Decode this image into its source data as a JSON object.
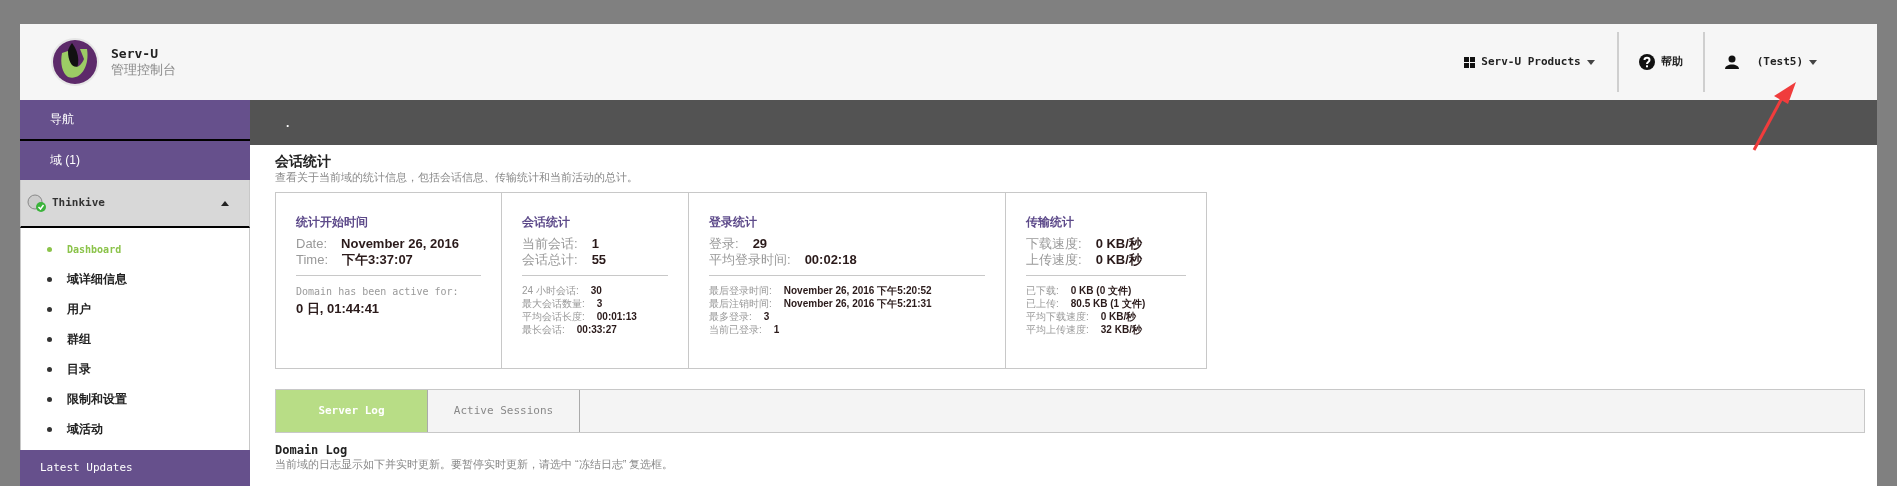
{
  "header": {
    "logo_title": "Serv-U",
    "logo_subtitle": "管理控制台",
    "menus": [
      {
        "kind": "products",
        "label": "Serv-U Products"
      },
      {
        "kind": "help",
        "label": "帮助"
      },
      {
        "kind": "user",
        "label": "(Test5)"
      }
    ]
  },
  "breadcrumb": ".",
  "sidebar": {
    "nav_title": "导航",
    "domains_header": "域 (1)",
    "domain": {
      "name": "Thinkive",
      "expanded": true,
      "items": [
        {
          "label": "Dashboard",
          "selected": true
        },
        {
          "label": "域详细信息",
          "selected": false
        },
        {
          "label": "用户",
          "selected": false
        },
        {
          "label": "群组",
          "selected": false
        },
        {
          "label": "目录",
          "selected": false
        },
        {
          "label": "限制和设置",
          "selected": false
        },
        {
          "label": "域活动",
          "selected": false
        }
      ]
    },
    "latest_updates": "Latest Updates"
  },
  "page": {
    "title": "会话统计",
    "description": "查看关于当前域的统计信息，包括会话信息、传输统计和当前活动的总计。"
  },
  "stats": [
    {
      "kind": "start",
      "title": "统计开始时间",
      "main_rows": [
        {
          "label": "Date:",
          "value": "November 26, 2016"
        },
        {
          "label": "Time:",
          "value": "下午3:37:07"
        }
      ],
      "active_label": "Domain has been active for:",
      "active_value": "0 日, 01:44:41"
    },
    {
      "kind": "list",
      "title": "会话统计",
      "main_rows": [
        {
          "label": "当前会话:",
          "value": "1"
        },
        {
          "label": "会话总计:",
          "value": "55"
        }
      ],
      "detail_rows": [
        {
          "label": "24 小时会话:",
          "value": "30"
        },
        {
          "label": "最大会话数量:",
          "value": "3"
        },
        {
          "label": "平均会话长度:",
          "value": "00:01:13"
        },
        {
          "label": "最长会话:",
          "value": "00:33:27"
        }
      ]
    },
    {
      "kind": "list",
      "title": "登录统计",
      "main_rows": [
        {
          "label": "登录:",
          "value": "29"
        },
        {
          "label": "平均登录时间:",
          "value": "00:02:18"
        }
      ],
      "detail_rows": [
        {
          "label": "最后登录时间:",
          "value": "November 26, 2016 下午5:20:52"
        },
        {
          "label": "最后注销时间:",
          "value": "November 26, 2016 下午5:21:31"
        },
        {
          "label": "最多登录:",
          "value": "3"
        },
        {
          "label": "当前已登录:",
          "value": "1"
        }
      ]
    },
    {
      "kind": "list",
      "title": "传输统计",
      "main_rows": [
        {
          "label": "下载速度:",
          "value": "0 KB/秒"
        },
        {
          "label": "上传速度:",
          "value": "0 KB/秒"
        }
      ],
      "detail_rows": [
        {
          "label": "已下载:",
          "value": "0 KB (0 文件)"
        },
        {
          "label": "已上传:",
          "value": "80.5 KB (1 文件)"
        },
        {
          "label": "平均下载速度:",
          "value": "0 KB/秒"
        },
        {
          "label": "平均上传速度:",
          "value": "32 KB/秒"
        }
      ]
    }
  ],
  "tabs": [
    {
      "label": "Server Log",
      "selected": true
    },
    {
      "label": "Active Sessions",
      "selected": false
    }
  ],
  "log": {
    "title": "Domain Log",
    "description": "当前域的日志显示如下并实时更新。要暂停实时更新，请选中 “冻结日志” 复选框。"
  }
}
